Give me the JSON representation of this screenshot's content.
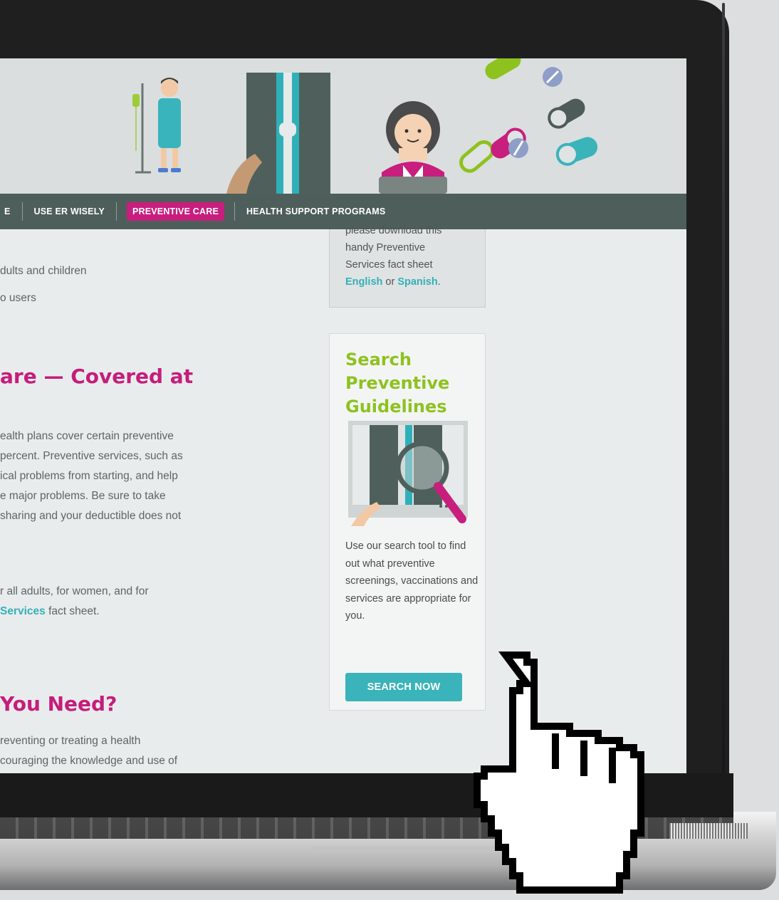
{
  "nav": {
    "items": [
      {
        "label": "E"
      },
      {
        "label": "USE ER WISELY"
      },
      {
        "label": "PREVENTIVE CARE"
      },
      {
        "label": "HEALTH SUPPORT PROGRAMS"
      }
    ],
    "active": "PREVENTIVE CARE"
  },
  "main": {
    "list_1": "dults and children",
    "list_2": "o users",
    "heading_1": "are — Covered at",
    "para_1": [
      "ealth plans cover certain preventive",
      "percent. Preventive services, such as",
      "ical problems from starting, and help",
      "e major problems. Be sure to take",
      " sharing and your deductible does not"
    ],
    "para_2_line_1": "r all adults, for women, and for",
    "para_2_link": "Services",
    "para_2_rest": " fact sheet.",
    "heading_2": "You Need?",
    "para_3": [
      "reventing or treating a health",
      "couraging the knowledge and use of"
    ]
  },
  "sidebar": {
    "download_box": {
      "line_0": "please download this",
      "line_1": "handy Preventive",
      "line_2": "Services fact sheet",
      "link_english": "English",
      "or_text": " or ",
      "link_spanish": "Spanish",
      "period": "."
    },
    "search": {
      "title": "Search Preventive Guidelines",
      "description": "Use our search tool to find out what preventive screenings, vaccinations and services are appropriate for you.",
      "button_label": "SEARCH NOW"
    }
  },
  "colors": {
    "nav_bg": "#4e5e5a",
    "accent_magenta": "#c81e7e",
    "accent_teal": "#3ab3ba",
    "accent_green": "#8ec21f"
  }
}
